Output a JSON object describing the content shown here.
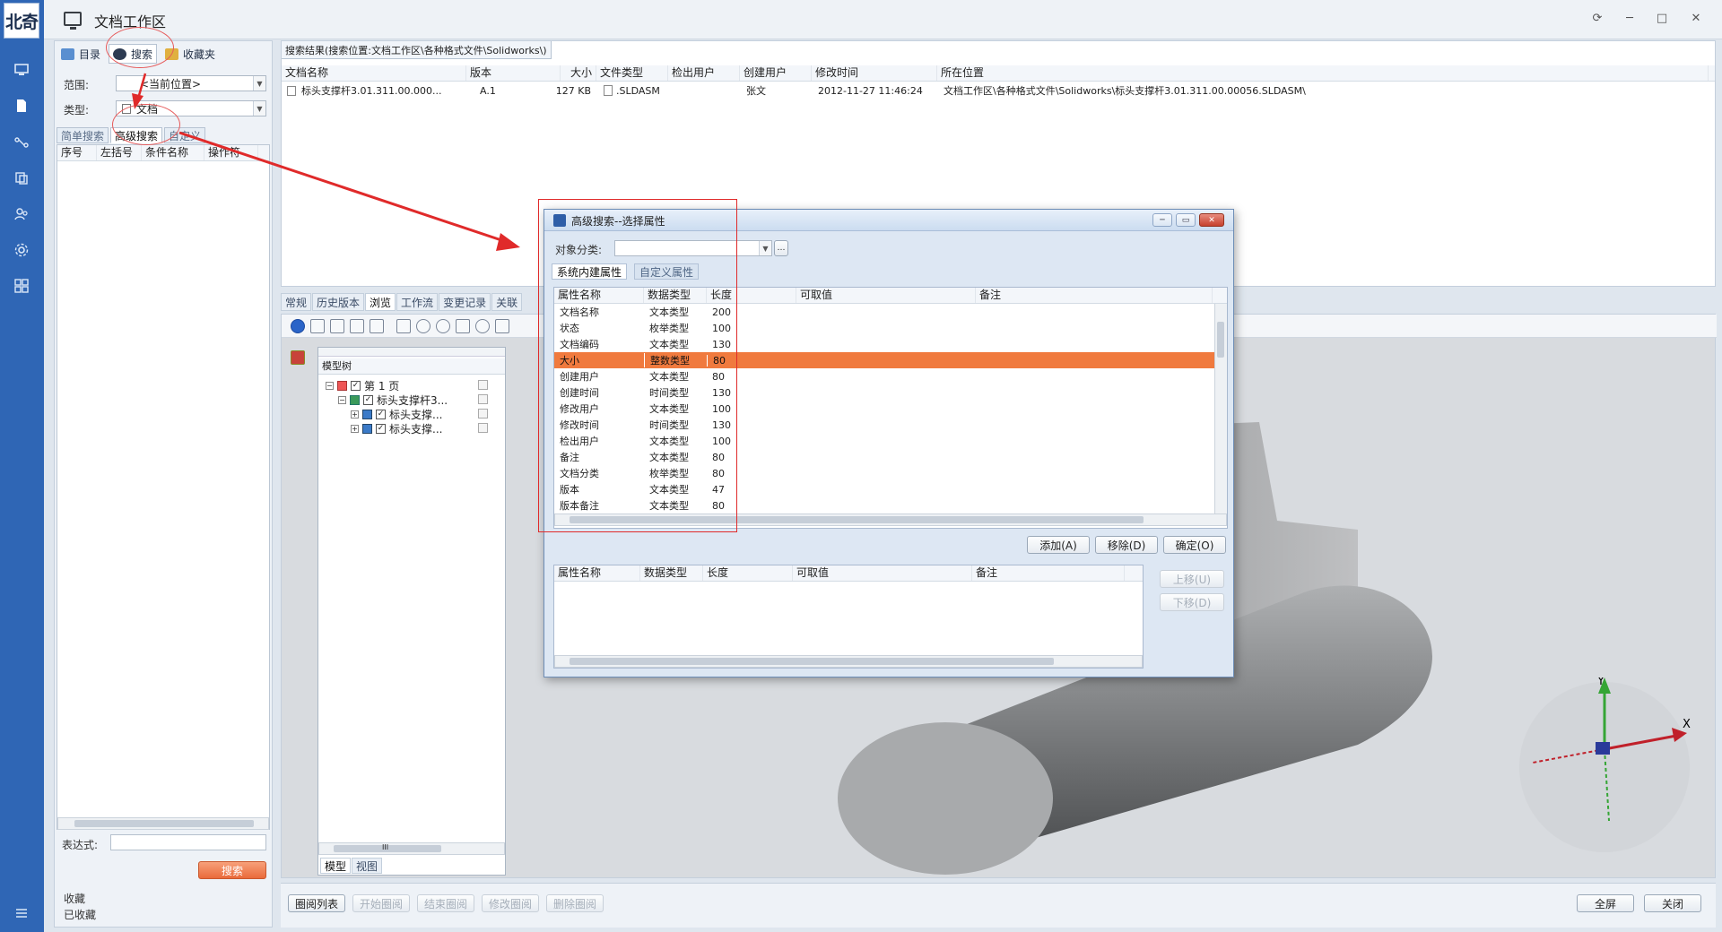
{
  "app": {
    "title": "文档工作区",
    "logo_text": "北奇"
  },
  "left_panel": {
    "tabs": [
      {
        "label": "目录"
      },
      {
        "label": "搜索"
      },
      {
        "label": "收藏夹"
      }
    ],
    "scope_label": "范围:",
    "scope_value": "<当前位置>",
    "type_label": "类型:",
    "type_value": "文档",
    "search_tabs": [
      {
        "label": "简单搜索"
      },
      {
        "label": "高级搜索"
      },
      {
        "label": "自定义"
      }
    ],
    "condition_columns": [
      "序号",
      "左括号",
      "条件名称",
      "操作符"
    ],
    "expression_label": "表达式:",
    "search_button": "搜索",
    "favorites_lines": [
      "收藏",
      "已收藏"
    ]
  },
  "results": {
    "title": "搜索结果(搜索位置:文档工作区\\各种格式文件\\Solidworks\\)",
    "columns": [
      "文档名称",
      "版本",
      "大小",
      "文件类型",
      "检出用户",
      "创建用户",
      "修改时间",
      "所在位置"
    ],
    "rows": [
      {
        "name": "标头支撑杆3.01.311.00.000...",
        "version": "A.1",
        "size": "127 KB",
        "type": ".SLDASM",
        "checkout": "",
        "creator": "张文",
        "modified": "2012-11-27 11:46:24",
        "location": "文档工作区\\各种格式文件\\Solidworks\\标头支撑杆3.01.311.00.00056.SLDASM\\"
      }
    ]
  },
  "bottom_tabs": [
    {
      "label": "常规"
    },
    {
      "label": "历史版本"
    },
    {
      "label": "浏览"
    },
    {
      "label": "工作流"
    },
    {
      "label": "变更记录"
    },
    {
      "label": "关联"
    }
  ],
  "model_tree": {
    "header": "模型树",
    "nodes": [
      {
        "label": "第 1 页"
      },
      {
        "label": "标头支撑杆3..."
      },
      {
        "label": "标头支撑..."
      },
      {
        "label": "标头支撑..."
      }
    ],
    "scroll_label": "III",
    "tabs": [
      {
        "label": "模型"
      },
      {
        "label": "视图"
      }
    ]
  },
  "footer": {
    "buttons": [
      {
        "label": "圈阅列表"
      },
      {
        "label": "开始圈阅"
      },
      {
        "label": "结束圈阅"
      },
      {
        "label": "修改圈阅"
      },
      {
        "label": "删除圈阅"
      }
    ],
    "fullscreen": "全屏",
    "close": "关闭"
  },
  "axes": {
    "x": "X",
    "y": "Y"
  },
  "dialog": {
    "title": "高级搜索--选择属性",
    "category_label": "对象分类:",
    "category_value": "",
    "tabs": [
      {
        "label": "系统内建属性"
      },
      {
        "label": "自定义属性"
      }
    ],
    "columns": [
      "属性名称",
      "数据类型",
      "长度",
      "可取值",
      "备注"
    ],
    "rows": [
      {
        "name": "文档名称",
        "type": "文本类型",
        "length": "200"
      },
      {
        "name": "状态",
        "type": "枚举类型",
        "length": "100"
      },
      {
        "name": "文档编码",
        "type": "文本类型",
        "length": "130"
      },
      {
        "name": "大小",
        "type": "整数类型",
        "length": "80"
      },
      {
        "name": "创建用户",
        "type": "文本类型",
        "length": "80"
      },
      {
        "name": "创建时间",
        "type": "时间类型",
        "length": "130"
      },
      {
        "name": "修改用户",
        "type": "文本类型",
        "length": "100"
      },
      {
        "name": "修改时间",
        "type": "时间类型",
        "length": "130"
      },
      {
        "name": "检出用户",
        "type": "文本类型",
        "length": "100"
      },
      {
        "name": "备注",
        "type": "文本类型",
        "length": "80"
      },
      {
        "name": "文档分类",
        "type": "枚举类型",
        "length": "80"
      },
      {
        "name": "版本",
        "type": "文本类型",
        "length": "47"
      },
      {
        "name": "版本备注",
        "type": "文本类型",
        "length": "80"
      }
    ],
    "selected_row": 3,
    "add_button": "添加(A)",
    "remove_button": "移除(D)",
    "ok_button": "确定(O)",
    "up_button": "上移(U)",
    "down_button": "下移(D)",
    "selected_columns": [
      "属性名称",
      "数据类型",
      "长度",
      "可取值",
      "备注"
    ]
  },
  "colors": {
    "rail": "#2f66b5",
    "highlight": "#f07a3e",
    "annotation": "#e02a2a"
  }
}
